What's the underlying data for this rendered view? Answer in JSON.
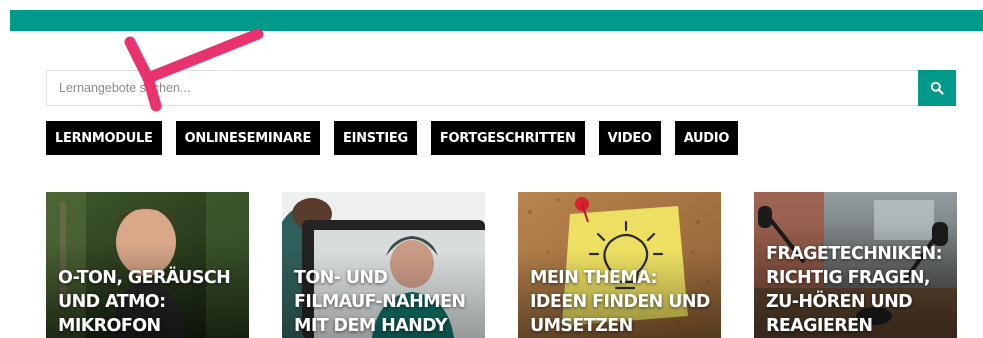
{
  "colors": {
    "accent": "#00998a",
    "annotation_arrow": "#e8336e"
  },
  "search": {
    "placeholder": "Lernangebote suchen...",
    "value": ""
  },
  "filters": [
    {
      "label": "LERNMODULE"
    },
    {
      "label": "ONLINESEMINARE"
    },
    {
      "label": "EINSTIEG"
    },
    {
      "label": "FORTGESCHRITTEN"
    },
    {
      "label": "VIDEO"
    },
    {
      "label": "AUDIO"
    }
  ],
  "cards": [
    {
      "title": "O-TON, GERÄUSCH UND ATMO: MIKROFON RICHTIG EINSETZEN",
      "image": "man-speaking-photo"
    },
    {
      "title": "TON- UND FILMAUF-NAHMEN MIT DEM HANDY",
      "image": "smartphone-recording-illustration"
    },
    {
      "title": "MEIN THEMA: IDEEN FINDEN UND UMSETZEN",
      "image": "lightbulb-note-pinboard-photo"
    },
    {
      "title": "FRAGETECHNIKEN: RICHTIG FRAGEN, ZU-HÖREN UND REAGIEREN",
      "image": "podcast-studio-photo"
    }
  ]
}
